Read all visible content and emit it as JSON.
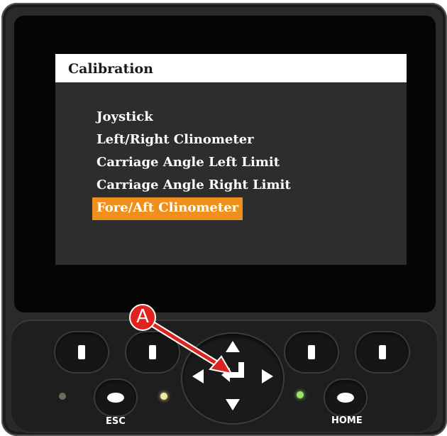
{
  "screen": {
    "title": "Calibration",
    "menu_items": [
      {
        "label": "Joystick",
        "selected": false
      },
      {
        "label": "Left/Right Clinometer",
        "selected": false
      },
      {
        "label": "Carriage Angle Left Limit",
        "selected": false
      },
      {
        "label": "Carriage Angle Right Limit",
        "selected": false
      },
      {
        "label": "Fore/Aft Clinometer",
        "selected": true
      }
    ]
  },
  "controls": {
    "esc_label": "ESC",
    "home_label": "HOME",
    "led_colors": {
      "left": "#6b6b5a",
      "middle": "#f3e9a0",
      "right": "#9be36a"
    }
  },
  "callout": {
    "label": "A",
    "color": "#e0231e"
  },
  "colors": {
    "highlight": "#f0901c",
    "screen_bg": "#2e2d2d",
    "header_bg": "#ffffff"
  },
  "icons": [
    "enter-icon",
    "up-arrow-icon",
    "down-arrow-icon",
    "left-arrow-icon",
    "right-arrow-icon",
    "callout-arrow-icon"
  ]
}
